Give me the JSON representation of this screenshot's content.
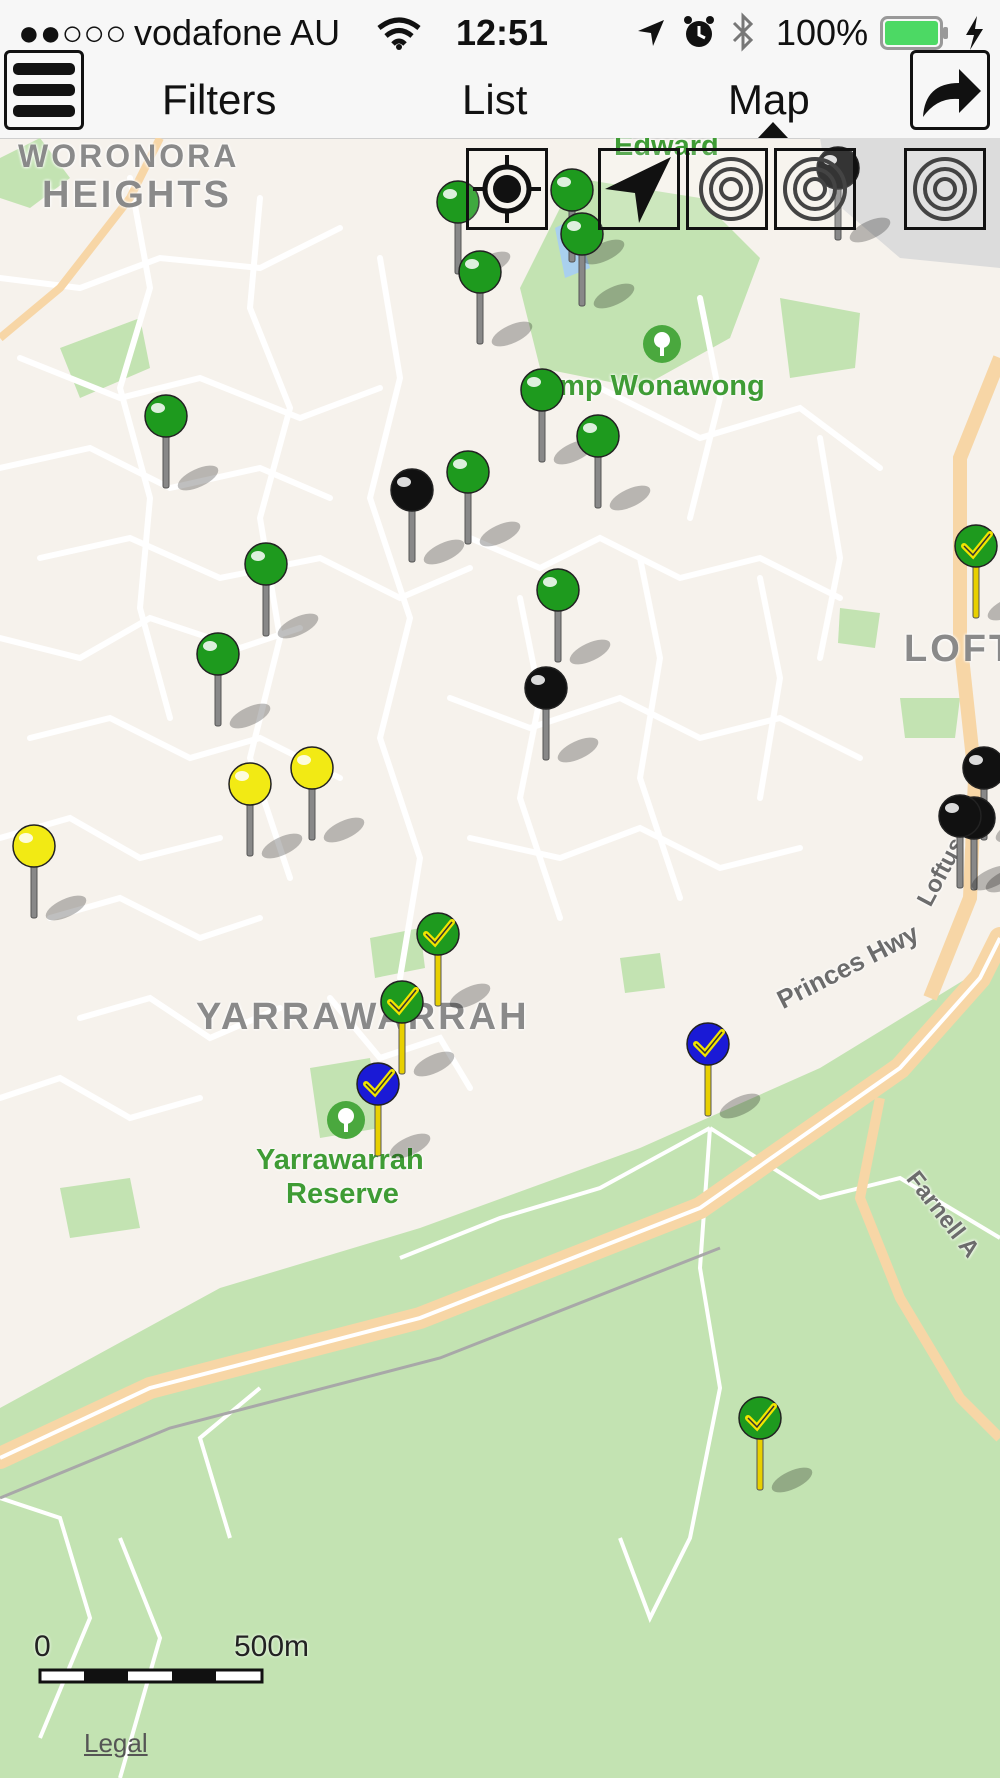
{
  "status_bar": {
    "carrier": "vodafone AU",
    "signal_dots": "●●○○○",
    "time": "12:51",
    "battery_percent": "100%",
    "icons": [
      "wifi-icon",
      "location-arrow-icon",
      "alarm-icon",
      "bluetooth-icon",
      "battery-icon",
      "charging-bolt-icon"
    ]
  },
  "nav": {
    "menu_icon": "hamburger-menu-icon",
    "tabs": [
      "Filters",
      "List",
      "Map"
    ],
    "active_tab": "Map",
    "share_icon": "share-arrow-icon"
  },
  "map_controls": [
    "crosshair-locate-icon",
    "navigation-arrow-icon",
    "target-rings-icon",
    "target-rings-icon",
    "target-rings-icon"
  ],
  "map": {
    "labels": {
      "woronora_line1": "WORONORA",
      "woronora_line2": "HEIGHTS",
      "yarrawarrah": "YARRAWARRAH",
      "loftus": "LOFT",
      "camp_park": "Camp Wonawong",
      "camp_top": "Edward",
      "reserve_line1": "Yarrawarrah",
      "reserve_line2": "Reserve",
      "princes_hwy": "Princes Hwy",
      "loftus_road": "Loftus",
      "farnell": "Farnell A"
    },
    "colors": {
      "land": "#f6f2ec",
      "park": "#c3e3b2",
      "road_major": "#f7d6a6",
      "road_minor": "#ffffff",
      "pin_green": "#1e9a1e",
      "pin_black": "#111111",
      "pin_yellow": "#f2ea14",
      "pin_blue": "#1a1ad6"
    },
    "pin_categories": [
      "green",
      "black",
      "yellow",
      "green-check",
      "blue-check"
    ],
    "scale": {
      "start": "0",
      "end": "500m"
    },
    "legal": "Legal"
  }
}
